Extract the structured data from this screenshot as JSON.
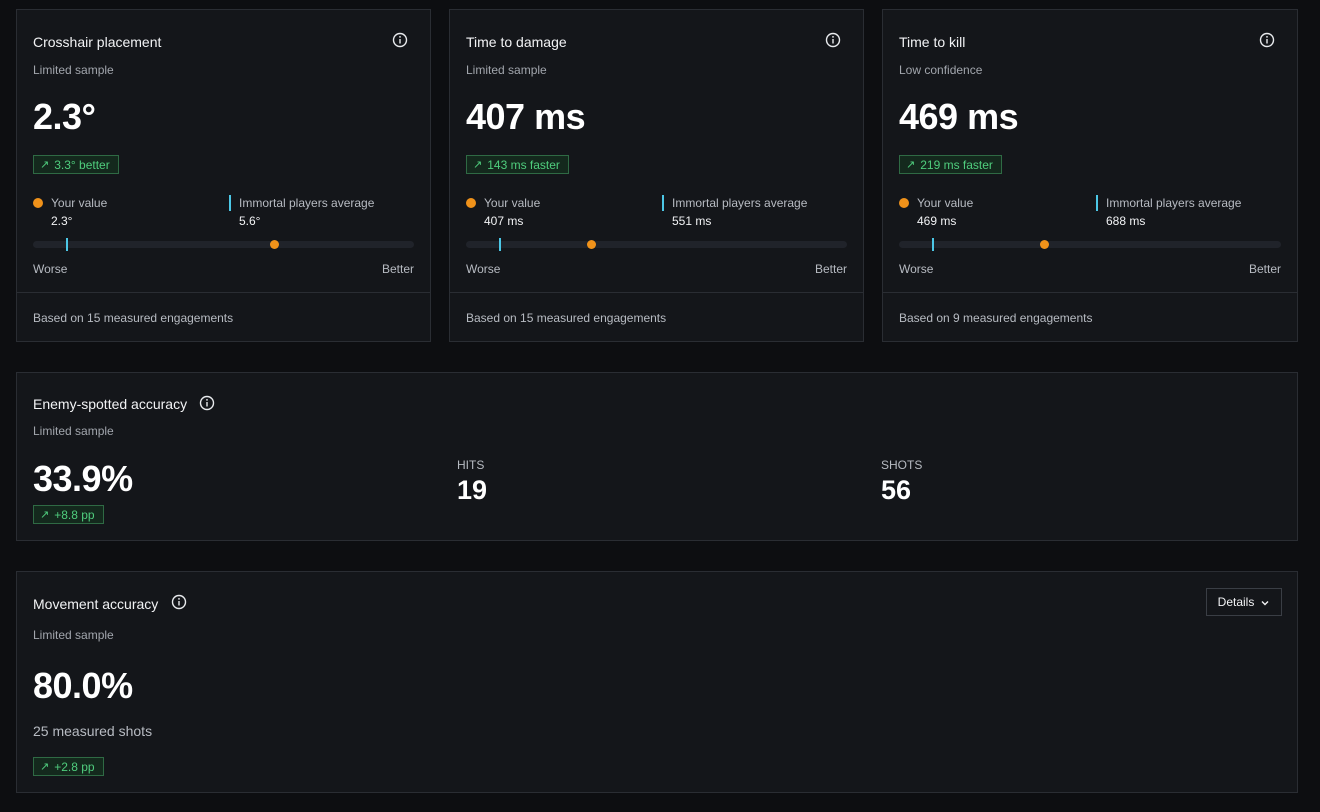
{
  "colors": {
    "background": "#0d0e11",
    "card": "#14161a",
    "border": "#2a2d33",
    "your_value": "#f0921a",
    "average_marker": "#4cc7e6",
    "positive": "#4fcd7d"
  },
  "metric_cards": [
    {
      "title": "Crosshair placement",
      "confidence": "Limited sample",
      "value": "2.3°",
      "delta": "3.3° better",
      "delta_icon": "arrow-up-right-icon",
      "your_label": "Your value",
      "your_value": "2.3°",
      "avg_label": "Immortal players average",
      "avg_value": "5.6°",
      "worse_label": "Worse",
      "better_label": "Better",
      "avg_marker_fraction": 0.09,
      "your_dot_fraction": 0.635,
      "footer": "Based on 15 measured engagements"
    },
    {
      "title": "Time to damage",
      "confidence": "Limited sample",
      "value": "407 ms",
      "delta": "143 ms faster",
      "delta_icon": "arrow-up-right-icon",
      "your_label": "Your value",
      "your_value": "407 ms",
      "avg_label": "Immortal players average",
      "avg_value": "551 ms",
      "worse_label": "Worse",
      "better_label": "Better",
      "avg_marker_fraction": 0.09,
      "your_dot_fraction": 0.33,
      "footer": "Based on 15 measured engagements"
    },
    {
      "title": "Time to kill",
      "confidence": "Low confidence",
      "value": "469 ms",
      "delta": "219 ms faster",
      "delta_icon": "arrow-up-right-icon",
      "your_label": "Your value",
      "your_value": "469 ms",
      "avg_label": "Immortal players average",
      "avg_value": "688 ms",
      "worse_label": "Worse",
      "better_label": "Better",
      "avg_marker_fraction": 0.09,
      "your_dot_fraction": 0.38,
      "footer": "Based on 9 measured engagements"
    }
  ],
  "enemy_spotted": {
    "title": "Enemy-spotted accuracy",
    "confidence": "Limited sample",
    "value": "33.9%",
    "delta": "+8.8 pp",
    "hits_label": "HITS",
    "hits_value": "19",
    "shots_label": "SHOTS",
    "shots_value": "56"
  },
  "movement": {
    "title": "Movement accuracy",
    "confidence": "Limited sample",
    "value": "80.0%",
    "shots_text": "25 measured shots",
    "delta": "+2.8 pp",
    "details_label": "Details"
  }
}
